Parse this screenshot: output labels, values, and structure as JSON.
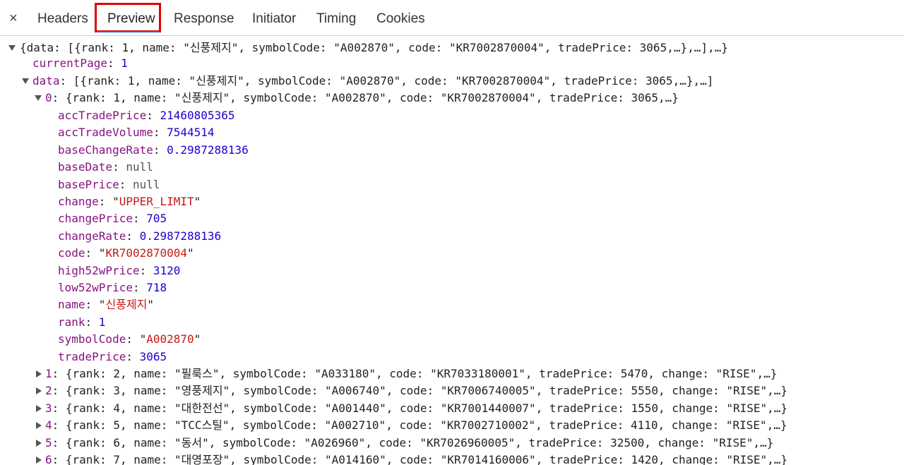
{
  "tabs": {
    "close": "×",
    "headers": "Headers",
    "preview": "Preview",
    "response": "Response",
    "initiator": "Initiator",
    "timing": "Timing",
    "cookies": "Cookies"
  },
  "preview": {
    "root_summary": "{data: [{rank: 1, name: \"신풍제지\", symbolCode: \"A002870\", code: \"KR7002870004\", tradePrice: 3065,…},…],…}",
    "current_page_key": "currentPage",
    "current_page_value": "1",
    "data_key": "data",
    "data_summary": "[{rank: 1, name: \"신풍제지\", symbolCode: \"A002870\", code: \"KR7002870004\", tradePrice: 3065,…},…]",
    "item0_index": "0",
    "item0_summary": "{rank: 1, name: \"신풍제지\", symbolCode: \"A002870\", code: \"KR7002870004\", tradePrice: 3065,…}",
    "fields": [
      {
        "key": "accTradePrice",
        "value": "21460805365",
        "kind": "num"
      },
      {
        "key": "accTradeVolume",
        "value": "7544514",
        "kind": "num"
      },
      {
        "key": "baseChangeRate",
        "value": "0.2987288136",
        "kind": "num"
      },
      {
        "key": "baseDate",
        "value": "null",
        "kind": "nul"
      },
      {
        "key": "basePrice",
        "value": "null",
        "kind": "nul"
      },
      {
        "key": "change",
        "value": "UPPER_LIMIT",
        "kind": "str"
      },
      {
        "key": "changePrice",
        "value": "705",
        "kind": "num"
      },
      {
        "key": "changeRate",
        "value": "0.2987288136",
        "kind": "num"
      },
      {
        "key": "code",
        "value": "KR7002870004",
        "kind": "str"
      },
      {
        "key": "high52wPrice",
        "value": "3120",
        "kind": "num"
      },
      {
        "key": "low52wPrice",
        "value": "718",
        "kind": "num"
      },
      {
        "key": "name",
        "value": "신풍제지",
        "kind": "str"
      },
      {
        "key": "rank",
        "value": "1",
        "kind": "num"
      },
      {
        "key": "symbolCode",
        "value": "A002870",
        "kind": "str"
      },
      {
        "key": "tradePrice",
        "value": "3065",
        "kind": "num"
      }
    ],
    "collapsed_items": [
      {
        "index": "1",
        "summary": "{rank: 2, name: \"필룩스\", symbolCode: \"A033180\", code: \"KR7033180001\", tradePrice: 5470, change: \"RISE\",…}"
      },
      {
        "index": "2",
        "summary": "{rank: 3, name: \"영풍제지\", symbolCode: \"A006740\", code: \"KR7006740005\", tradePrice: 5550, change: \"RISE\",…}"
      },
      {
        "index": "3",
        "summary": "{rank: 4, name: \"대한전선\", symbolCode: \"A001440\", code: \"KR7001440007\", tradePrice: 1550, change: \"RISE\",…}"
      },
      {
        "index": "4",
        "summary": "{rank: 5, name: \"TCC스틸\", symbolCode: \"A002710\", code: \"KR7002710002\", tradePrice: 4110, change: \"RISE\",…}"
      },
      {
        "index": "5",
        "summary": "{rank: 6, name: \"동서\", symbolCode: \"A026960\", code: \"KR7026960005\", tradePrice: 32500, change: \"RISE\",…}"
      },
      {
        "index": "6",
        "summary": "{rank: 7, name: \"대영포장\", symbolCode: \"A014160\", code: \"KR7014160006\", tradePrice: 1420, change: \"RISE\",…}"
      }
    ]
  },
  "colors": {
    "active_tab_outline": "#e00000",
    "key": "#881280",
    "number": "#1c00cf",
    "string": "#c41a16"
  }
}
